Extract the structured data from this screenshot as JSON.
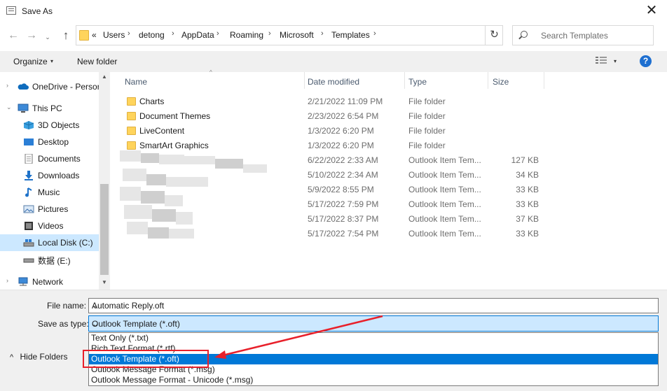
{
  "window": {
    "title": "Save As",
    "close": "✕"
  },
  "nav": {
    "back": "←",
    "forward": "→",
    "dropdown": "⌄",
    "up": "↑",
    "refresh": "↻",
    "breadcrumbs": [
      "«",
      "Users",
      "detong",
      "AppData",
      "Roaming",
      "Microsoft",
      "Templates"
    ],
    "separator": "›",
    "search_placeholder": "Search Templates"
  },
  "toolbar": {
    "organize": "Organize",
    "new_folder": "New folder",
    "organize_arrow": "▾",
    "view_arrow": "▾",
    "help": "?"
  },
  "sidebar": {
    "items": [
      {
        "label": "OneDrive - Persor",
        "icon": "cloud-icon",
        "expander": "›"
      },
      {
        "label": "This PC",
        "icon": "computer-icon",
        "expander": "⌄"
      },
      {
        "label": "3D Objects",
        "icon": "cube-icon"
      },
      {
        "label": "Desktop",
        "icon": "desktop-icon"
      },
      {
        "label": "Documents",
        "icon": "document-icon"
      },
      {
        "label": "Downloads",
        "icon": "download-icon"
      },
      {
        "label": "Music",
        "icon": "music-icon"
      },
      {
        "label": "Pictures",
        "icon": "pictures-icon"
      },
      {
        "label": "Videos",
        "icon": "video-icon"
      },
      {
        "label": "Local Disk (C:)",
        "icon": "drive-icon"
      },
      {
        "label": "数据 (E:)",
        "icon": "drive-icon"
      },
      {
        "label": "Network",
        "icon": "network-icon",
        "expander": "›"
      }
    ],
    "scroll_up": "▲",
    "scroll_down": "▼"
  },
  "columns": {
    "name": "Name",
    "date": "Date modified",
    "type": "Type",
    "size": "Size",
    "sort_arrow": "^"
  },
  "files": [
    {
      "name": "Charts",
      "date": "2/21/2022 11:09 PM",
      "type": "File folder",
      "size": ""
    },
    {
      "name": "Document Themes",
      "date": "2/23/2022 6:54 PM",
      "type": "File folder",
      "size": ""
    },
    {
      "name": "LiveContent",
      "date": "1/3/2022 6:20 PM",
      "type": "File folder",
      "size": ""
    },
    {
      "name": "SmartArt Graphics",
      "date": "1/3/2022 6:20 PM",
      "type": "File folder",
      "size": ""
    },
    {
      "name": "",
      "date": "6/22/2022 2:33 AM",
      "type": "Outlook Item Tem...",
      "size": "127 KB"
    },
    {
      "name": "",
      "date": "5/10/2022 2:34 AM",
      "type": "Outlook Item Tem...",
      "size": "34 KB"
    },
    {
      "name": "",
      "date": "5/9/2022 8:55 PM",
      "type": "Outlook Item Tem...",
      "size": "33 KB"
    },
    {
      "name": "",
      "date": "5/17/2022 7:59 PM",
      "type": "Outlook Item Tem...",
      "size": "33 KB"
    },
    {
      "name": "",
      "date": "5/17/2022 8:37 PM",
      "type": "Outlook Item Tem...",
      "size": "37 KB"
    },
    {
      "name": "",
      "date": "5/17/2022 7:54 PM",
      "type": "Outlook Item Tem...",
      "size": "33 KB"
    }
  ],
  "bottom": {
    "file_name_label": "File name:",
    "file_name_value": "Automatic Reply.oft",
    "save_type_label": "Save as type:",
    "save_type_value": "Outlook Template (*.oft)",
    "hide_folders": "Hide Folders",
    "hide_arrow": "^",
    "select_arrow": "⌄",
    "type_options": [
      "Text Only (*.txt)",
      "Rich Text Format (*.rtf)",
      "Outlook Template (*.oft)",
      "Outlook Message Format (*.msg)",
      "Outlook Message Format - Unicode (*.msg)"
    ],
    "selected_option_index": 2
  },
  "colors": {
    "accent": "#0078d7",
    "selection": "#cce8ff",
    "annotation": "#e8202a",
    "folder": "#ffd45c"
  }
}
